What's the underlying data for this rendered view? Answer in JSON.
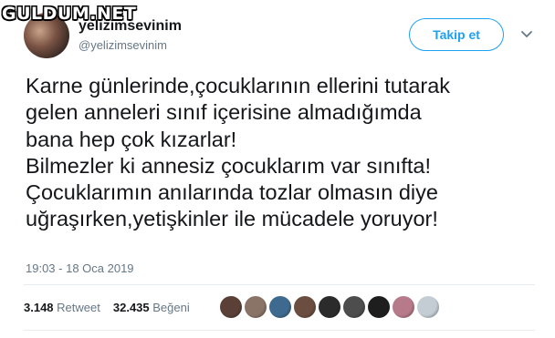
{
  "watermark": "GULDUM.NET",
  "user": {
    "display_name": "yelizimsevinim",
    "handle": "@yelizimsevinim"
  },
  "follow_label": "Takip et",
  "tweet_lines": [
    "Karne günlerinde,çocuklarının ellerini tutarak",
    "gelen anneleri sınıf içerisine almadığımda",
    "bana hep çok kızarlar!",
    "Bilmezler ki annesiz çocuklarım var sınıfta!",
    "Çocuklarımın anılarında tozlar olmasın diye",
    "uğraşırken,yetişkinler ile mücadele yoruyor!"
  ],
  "timestamp": "19:03 - 18 Oca 2019",
  "stats": {
    "retweet_count": "3.148",
    "retweet_label": "Retweet",
    "like_count": "32.435",
    "like_label": "Beğeni"
  },
  "liker_colors": [
    "#5a4036",
    "#8a7468",
    "#3f6a8f",
    "#6b4e3f",
    "#2b2b2b",
    "#4d4d4d",
    "#1e1e1e",
    "#b77a8a",
    "#c4ccd4"
  ],
  "colors": {
    "accent": "#1da1f2",
    "text": "#14171a",
    "secondary": "#657786",
    "divider": "#e6ecf0"
  },
  "icons": {
    "menu": "chevron-down-icon"
  }
}
